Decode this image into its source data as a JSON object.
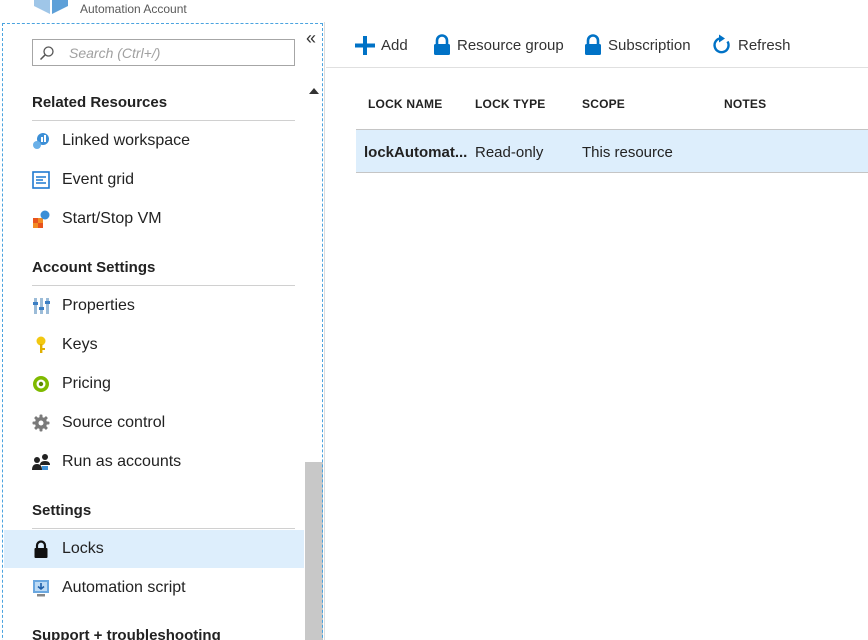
{
  "header": {
    "subtitle": "Automation Account"
  },
  "sidebar": {
    "search_placeholder": "Search (Ctrl+/)",
    "collapse_glyph": "«",
    "sections": {
      "related": {
        "title": "Related Resources",
        "items": [
          {
            "label": "Linked workspace",
            "icon": "linked-workspace-icon"
          },
          {
            "label": "Event grid",
            "icon": "event-grid-icon"
          },
          {
            "label": "Start/Stop VM",
            "icon": "start-stop-vm-icon"
          }
        ]
      },
      "account": {
        "title": "Account Settings",
        "items": [
          {
            "label": "Properties",
            "icon": "properties-icon"
          },
          {
            "label": "Keys",
            "icon": "key-icon"
          },
          {
            "label": "Pricing",
            "icon": "pricing-icon"
          },
          {
            "label": "Source control",
            "icon": "gear-icon"
          },
          {
            "label": "Run as accounts",
            "icon": "run-as-accounts-icon"
          }
        ]
      },
      "settings": {
        "title": "Settings",
        "items": [
          {
            "label": "Locks",
            "icon": "lock-icon",
            "active": true
          },
          {
            "label": "Automation script",
            "icon": "automation-script-icon"
          }
        ]
      },
      "support": {
        "title": "Support + troubleshooting"
      }
    }
  },
  "toolbar": {
    "add": "Add",
    "resource_group": "Resource group",
    "subscription": "Subscription",
    "refresh": "Refresh"
  },
  "table": {
    "columns": [
      "LOCK NAME",
      "LOCK TYPE",
      "SCOPE",
      "NOTES"
    ],
    "rows": [
      {
        "name": "lockAutomat...",
        "type": "Read-only",
        "scope": "This resource",
        "notes": ""
      }
    ]
  },
  "colors": {
    "accent": "#0072c6",
    "selected_bg": "#ddeefc"
  }
}
